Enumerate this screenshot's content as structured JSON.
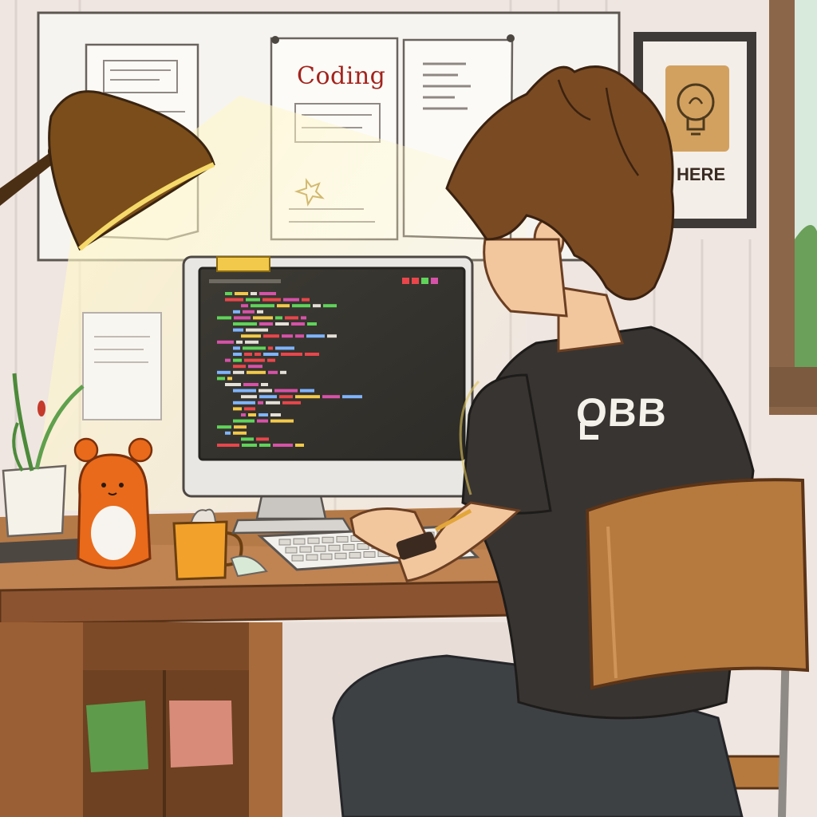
{
  "scene": {
    "poster_left": {
      "title": "Coding"
    },
    "poster_right": {
      "caption": "HERE",
      "icon": "lightbulb-icon"
    },
    "shirt": {
      "text": "OBB"
    },
    "monitor": {
      "content": "code-editor",
      "dot_colors": [
        "#e8464b",
        "#e8464b",
        "#5fd35a",
        "#d652a8"
      ]
    }
  },
  "colors": {
    "wall": "#f1e9e4",
    "desk": "#a86b3c",
    "shirt": "#383431",
    "hair": "#7a4a22",
    "lamp": "#6b4316",
    "mug": "#f2a22a",
    "toy": "#e86a1a"
  }
}
